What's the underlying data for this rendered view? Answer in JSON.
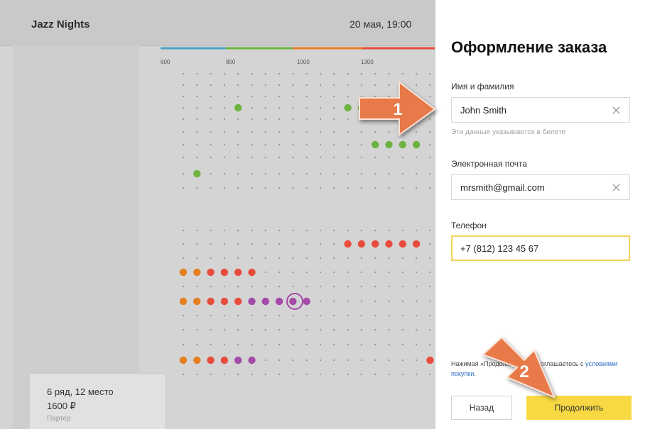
{
  "header": {
    "event_title": "Jazz Nights",
    "event_date": "20 мая, 19:00"
  },
  "seat_map": {
    "price_scale": [
      "600",
      "800",
      "1000",
      "1300"
    ],
    "scale_colors": [
      "#4aa3c9",
      "#6db33f",
      "#e67e22",
      "#e74c3c"
    ],
    "dot_colors": {
      "green": "#6db33f",
      "orange": "#e67e22",
      "red": "#e74c3c",
      "purple": "#a44aa8"
    }
  },
  "selected_seat": {
    "line": "6 ряд, 12 место",
    "price": "1600 ₽",
    "section": "Партер"
  },
  "form": {
    "title": "Оформление заказа",
    "name": {
      "label": "Имя и фамилия",
      "value": "John Smith",
      "hint": "Эти данные указываются в билете"
    },
    "email": {
      "label": "Электронная почта",
      "value": "mrsmith@gmail.com"
    },
    "phone": {
      "label": "Телефон",
      "value": "+7 (812) 123 45 67"
    },
    "consent_text": "Нажимая «Продолжить», вы соглашаетесь с",
    "consent_link": "условиями покупки",
    "back_label": "Назад",
    "continue_label": "Продолжить"
  },
  "callouts": {
    "first": "1",
    "second": "2"
  },
  "icons": {
    "clear": "close-icon",
    "arrow": "arrow-callout-icon"
  }
}
